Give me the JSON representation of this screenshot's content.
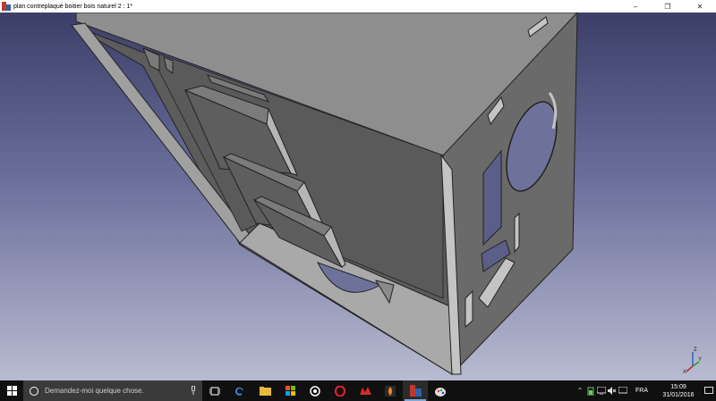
{
  "window": {
    "title": "plan contreplaqué boitier bois naturel 2 : 1*",
    "minimize_glyph": "–",
    "maximize_glyph": "❐",
    "close_glyph": "✕"
  },
  "viewport": {
    "navigation_cube_axis_labels": [
      "Z",
      "Y",
      "X"
    ]
  },
  "taskbar": {
    "search_placeholder": "Demandez-moi quelque chose.",
    "apps": [
      {
        "name": "task-view",
        "icon": "task-view-icon"
      },
      {
        "name": "edge",
        "icon": "edge-icon"
      },
      {
        "name": "file-explorer",
        "icon": "folder-icon"
      },
      {
        "name": "store",
        "icon": "store-icon"
      },
      {
        "name": "app-circle",
        "icon": "circle-app-icon"
      },
      {
        "name": "opera",
        "icon": "opera-icon"
      },
      {
        "name": "app-red",
        "icon": "red-app-icon"
      },
      {
        "name": "app-flame",
        "icon": "flame-icon"
      },
      {
        "name": "freecad",
        "icon": "freecad-icon",
        "active": true
      },
      {
        "name": "app-paint",
        "icon": "paint-icon"
      }
    ],
    "tray": {
      "language": "FRA",
      "time": "15:09",
      "date": "31/01/2016"
    }
  },
  "colors": {
    "accent": "#7fa7d8",
    "taskbar": "#101010",
    "viewport_top": "#3b3f68",
    "viewport_bottom": "#b9bbd0"
  }
}
